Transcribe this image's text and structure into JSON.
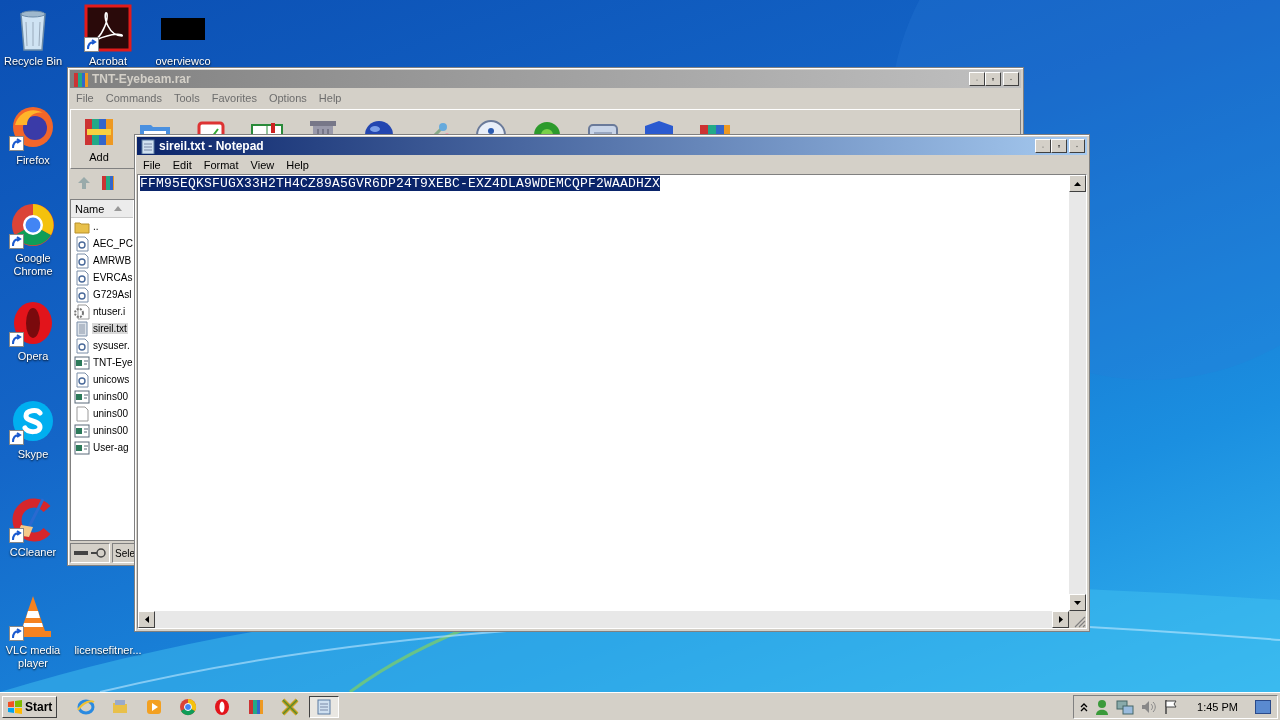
{
  "desktop_icons": [
    {
      "label": "Recycle Bin",
      "kind": "recycle",
      "shortcut": false
    },
    {
      "label": "Acrobat",
      "kind": "acrobat",
      "shortcut": true
    },
    {
      "label": "overviewco",
      "kind": "thumbnail",
      "shortcut": false
    },
    {
      "label": "Firefox",
      "kind": "firefox",
      "shortcut": true
    },
    {
      "label": "Google Chrome",
      "kind": "chrome",
      "shortcut": true
    },
    {
      "label": "Opera",
      "kind": "opera",
      "shortcut": true
    },
    {
      "label": "Skype",
      "kind": "skype",
      "shortcut": true
    },
    {
      "label": "CCleaner",
      "kind": "ccleaner",
      "shortcut": true
    },
    {
      "label": "VLC media player",
      "kind": "vlc",
      "shortcut": true
    },
    {
      "label": "licensefitner...",
      "shortcut": false
    }
  ],
  "archiver": {
    "title": "TNT-Eyebeam.rar",
    "active": false,
    "menu": [
      "File",
      "Commands",
      "Tools",
      "Favorites",
      "Options",
      "Help"
    ],
    "toolbar": [
      {
        "label": "Add",
        "kind": "add"
      },
      {
        "kind": "extract"
      },
      {
        "kind": "test"
      },
      {
        "kind": "view"
      },
      {
        "kind": "delete"
      },
      {
        "kind": "find"
      },
      {
        "kind": "wizard"
      },
      {
        "kind": "info"
      },
      {
        "kind": "virus"
      },
      {
        "kind": "comment"
      },
      {
        "kind": "protect"
      },
      {
        "kind": "sfx"
      }
    ],
    "column": "Name",
    "files": [
      {
        "name": "..",
        "kind": "folder",
        "selected": false
      },
      {
        "name": "AEC_PC",
        "kind": "dll",
        "selected": false
      },
      {
        "name": "AMRWB",
        "kind": "dll",
        "selected": false
      },
      {
        "name": "EVRCAs",
        "kind": "dll",
        "selected": false
      },
      {
        "name": "G729Asl",
        "kind": "dll",
        "selected": false
      },
      {
        "name": "ntuser.i",
        "kind": "ini",
        "selected": false
      },
      {
        "name": "sireil.txt",
        "kind": "txt",
        "selected": true
      },
      {
        "name": "sysuser.",
        "kind": "dll",
        "selected": false
      },
      {
        "name": "TNT-Eye",
        "kind": "exe",
        "selected": false
      },
      {
        "name": "unicows",
        "kind": "dll",
        "selected": false
      },
      {
        "name": "unins00",
        "kind": "exe",
        "selected": false
      },
      {
        "name": "unins00",
        "kind": "blank",
        "selected": false
      },
      {
        "name": "unins00",
        "kind": "exe",
        "selected": false
      },
      {
        "name": "User-ag",
        "kind": "exe",
        "selected": false
      }
    ],
    "status": "Sele"
  },
  "notepad": {
    "title": "sireil.txt - Notepad",
    "active": true,
    "menu": [
      "File",
      "Edit",
      "Format",
      "View",
      "Help"
    ],
    "text": "FFM95EQKSFUGX33H2TH4CZ89A5GVR6DP24T9XEBC-EXZ4DLA9WDEMCQPF2WAADHZX",
    "text_selected": true
  },
  "taskbar": {
    "start": "Start",
    "items": [
      {
        "kind": "ie",
        "selected": false
      },
      {
        "kind": "explorer",
        "selected": false
      },
      {
        "kind": "media",
        "selected": false
      },
      {
        "kind": "chrome",
        "selected": false
      },
      {
        "kind": "opera",
        "selected": false
      },
      {
        "kind": "winrar",
        "selected": false
      },
      {
        "kind": "tool",
        "selected": false
      },
      {
        "kind": "notepad",
        "selected": true
      }
    ],
    "clock": "1:45 PM"
  }
}
